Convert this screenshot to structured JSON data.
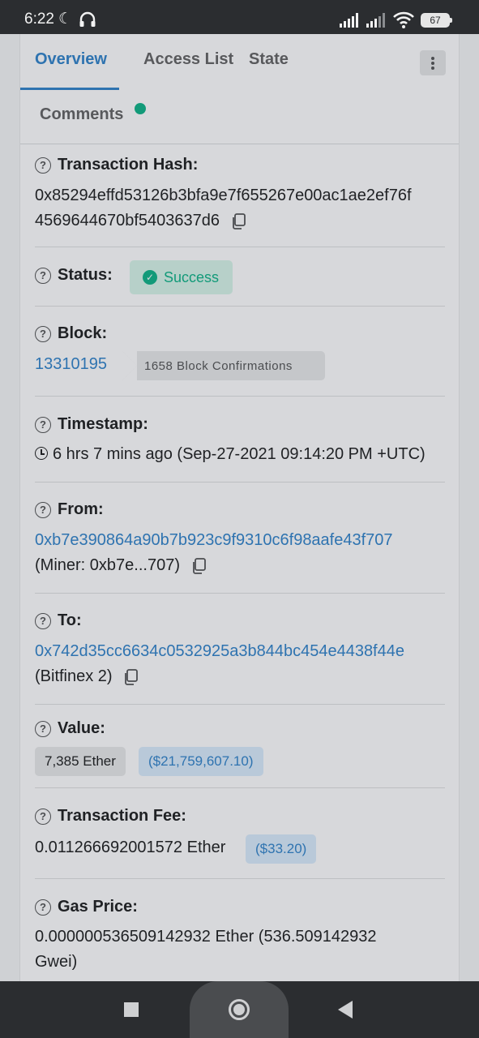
{
  "status_bar": {
    "time": "6:22",
    "battery": "67"
  },
  "tabs": [
    {
      "label": "Overview"
    },
    {
      "label": "Access List"
    },
    {
      "label": "State"
    },
    {
      "label": "Comments"
    }
  ],
  "tx": {
    "hash_label": "Transaction Hash:",
    "hash_line1": "0x85294effd53126b3bfa9e7f655267e00ac1ae2ef76f",
    "hash_line2": "4569644670bf5403637d6",
    "status_label": "Status:",
    "status_value": "Success",
    "block_label": "Block:",
    "block_value": "13310195",
    "block_confirmations": "1658 Block Confirmations",
    "timestamp_label": "Timestamp:",
    "timestamp_value": "6 hrs 7 mins ago (Sep-27-2021 09:14:20 PM +UTC)",
    "from_label": "From:",
    "from_address": "0xb7e390864a90b7b923c9f9310c6f98aafe43f707",
    "from_note": "(Miner: 0xb7e...707)",
    "to_label": "To:",
    "to_address": "0x742d35cc6634c0532925a3b844bc454e4438f44e",
    "to_note": "(Bitfinex 2)",
    "value_label": "Value:",
    "value_ether": "7,385 Ether",
    "value_usd": "($21,759,607.10)",
    "fee_label": "Transaction Fee:",
    "fee_ether": "0.011266692001572 Ether",
    "fee_usd": "($33.20)",
    "gas_label": "Gas Price:",
    "gas_line1": "0.000000536509142932 Ether (536.509142932",
    "gas_line2": "Gwei)"
  },
  "colors": {
    "link": "#2e73b0",
    "success": "#129a79"
  }
}
